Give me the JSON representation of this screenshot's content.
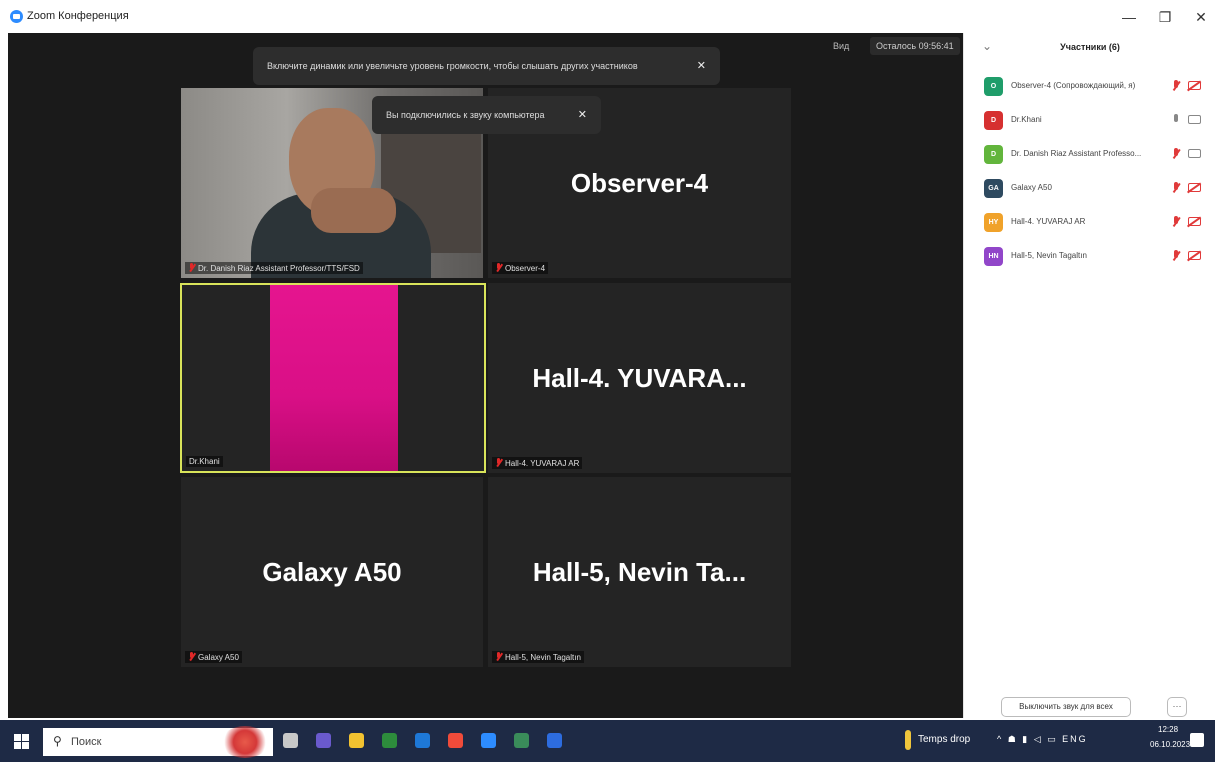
{
  "window": {
    "title": "Zoom Конференция",
    "min_glyph": "—",
    "max_glyph": "❐",
    "close_glyph": "✕"
  },
  "meeting": {
    "view_label": "Вид",
    "timer_label": "Осталось 09:56:41",
    "notice_volume": "Включите динамик или увеличьте уровень громкости, чтобы слышать других участников",
    "notice_audio": "Вы подключились к звуку компьютера",
    "close_glyph": "✕",
    "tiles": [
      {
        "big_name": "",
        "caption": "Dr. Danish Riaz Assistant Professor/TTS/FSD",
        "muted": true
      },
      {
        "big_name": "Observer-4",
        "caption": "Observer-4",
        "muted": true
      },
      {
        "big_name": "",
        "caption": "Dr.Khani",
        "muted": false
      },
      {
        "big_name": "Hall-4.  YUVARA...",
        "caption": "Hall-4. YUVARAJ AR",
        "muted": true
      },
      {
        "big_name": "Galaxy A50",
        "caption": "Galaxy A50",
        "muted": true
      },
      {
        "big_name": "Hall-5, Nevin Ta...",
        "caption": "Hall-5, Nevin Tagaltın",
        "muted": true
      }
    ]
  },
  "participants": {
    "title": "Участники (6)",
    "collapse_glyph": "⌄",
    "list": [
      {
        "initials": "O",
        "name": "Observer-4 (Сопровождающий, я)",
        "color": "#1f9d6a",
        "mic": "off",
        "cam": "off",
        "mic_color": "red",
        "cam_color": "red"
      },
      {
        "initials": "D",
        "name": "Dr.Khani",
        "color": "#d63030",
        "mic": "on",
        "cam": "on",
        "mic_color": "gray",
        "cam_color": "gray"
      },
      {
        "initials": "D",
        "name": "Dr. Danish Riaz Assistant Professo...",
        "color": "#62b53c",
        "mic": "off",
        "cam": "on",
        "mic_color": "red",
        "cam_color": "gray"
      },
      {
        "initials": "GA",
        "name": "Galaxy A50",
        "color": "#2e4a60",
        "mic": "off",
        "cam": "off",
        "mic_color": "red",
        "cam_color": "red"
      },
      {
        "initials": "HY",
        "name": "Hall-4. YUVARAJ AR",
        "color": "#f0a22a",
        "mic": "off",
        "cam": "off",
        "mic_color": "red",
        "cam_color": "red"
      },
      {
        "initials": "HN",
        "name": "Hall-5, Nevin Tagaltın",
        "color": "#9146c9",
        "mic": "off",
        "cam": "off",
        "mic_color": "red",
        "cam_color": "red"
      }
    ],
    "mute_all_label": "Выключить звук для всех",
    "more_label": "···"
  },
  "taskbar": {
    "search_placeholder": "Поиск",
    "search_glyph": "⚲",
    "weather_text": "Temps drop",
    "tray_icons": "^ ☗ ▮ ◁ ▭ ENG",
    "time": "12:28",
    "date": "06.10.2023",
    "app_icon_colors": [
      "#c8c8c8",
      "#6a5acd",
      "#f2c230",
      "#2d8c3c",
      "#1e78d7",
      "#f04b3a",
      "#2d8cff",
      "#3a8c5a",
      "#2d6cdf"
    ]
  }
}
